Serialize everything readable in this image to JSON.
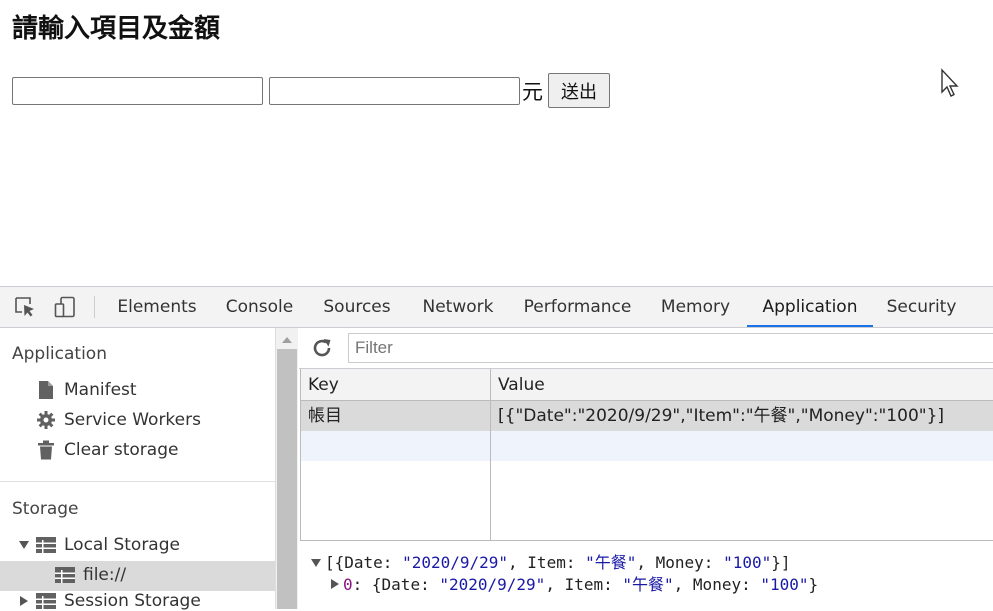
{
  "page": {
    "title": "請輸入項目及金額",
    "item_input_value": "",
    "amount_input_value": "",
    "unit": "元",
    "submit_label": "送出"
  },
  "devtools": {
    "tabs": [
      "Elements",
      "Console",
      "Sources",
      "Network",
      "Performance",
      "Memory",
      "Application",
      "Security"
    ],
    "active_tab": "Application",
    "sidebar": {
      "application_header": "Application",
      "manifest": "Manifest",
      "service_workers": "Service Workers",
      "clear_storage": "Clear storage",
      "storage_header": "Storage",
      "local_storage": "Local Storage",
      "file": "file://",
      "session_storage": "Session Storage"
    },
    "filter_placeholder": "Filter",
    "table": {
      "headers": [
        "Key",
        "Value"
      ],
      "rows": [
        {
          "key": "帳目",
          "value": "[{\"Date\":\"2020/9/29\",\"Item\":\"午餐\",\"Money\":\"100\"}]"
        }
      ]
    },
    "preview": {
      "line1_prefix": "[{Date: ",
      "date": "\"2020/9/29\"",
      "item_label": ", Item: ",
      "item": "\"午餐\"",
      "money_label": ", Money: ",
      "money": "\"100\"",
      "line1_suffix": "}]",
      "index": "0",
      "line2_prefix": ": {Date: ",
      "line2_suffix": "}"
    },
    "colors": {
      "accent": "#1a73e8",
      "selected_row": "#dadada"
    }
  }
}
